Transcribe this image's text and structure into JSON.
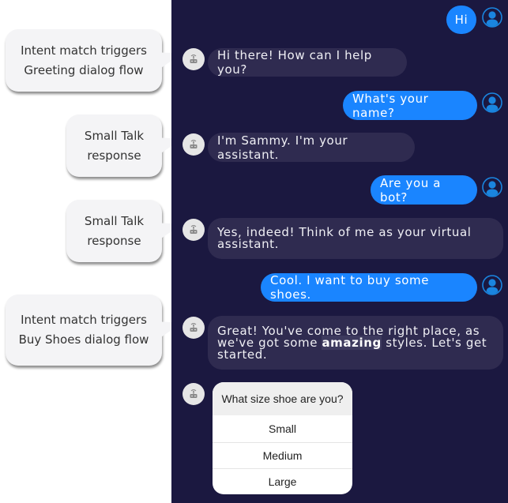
{
  "callouts": [
    {
      "text": "Intent match triggers\nGreeting dialog flow"
    },
    {
      "text": "Small Talk\nresponse"
    },
    {
      "text": "Small Talk\nresponse"
    },
    {
      "text": "Intent match triggers\nBuy Shoes dialog flow"
    }
  ],
  "messages": [
    {
      "sender": "user",
      "text": "Hi",
      "avatar_icon": "user-avatar-icon"
    },
    {
      "sender": "bot",
      "text": "Hi there! How can I help you?",
      "avatar_icon": "robot-icon"
    },
    {
      "sender": "user",
      "text": "What's your name?",
      "avatar_icon": "user-avatar-icon"
    },
    {
      "sender": "bot",
      "text": "I'm Sammy. I'm your assistant.",
      "avatar_icon": "robot-icon"
    },
    {
      "sender": "user",
      "text": "Are you a bot?",
      "avatar_icon": "user-avatar-icon"
    },
    {
      "sender": "bot",
      "text": "Yes, indeed! Think of me as your virtual assistant.",
      "avatar_icon": "robot-icon"
    },
    {
      "sender": "user",
      "text": "Cool. I want to buy some shoes.",
      "avatar_icon": "user-avatar-icon"
    },
    {
      "sender": "bot",
      "text_before": "Great! You've come to the right place, as we've got some ",
      "text_bold": "amazing",
      "text_after": " styles. Let's get started.",
      "avatar_icon": "robot-icon"
    }
  ],
  "card": {
    "title": "What size shoe are you?",
    "options": [
      "Small",
      "Medium",
      "Large"
    ]
  },
  "colors": {
    "panel_bg": "#1b1840",
    "bot_bubble": "#2f2b50",
    "user_bubble": "#1a85ff",
    "callout_bg": "#f4f4f6"
  }
}
